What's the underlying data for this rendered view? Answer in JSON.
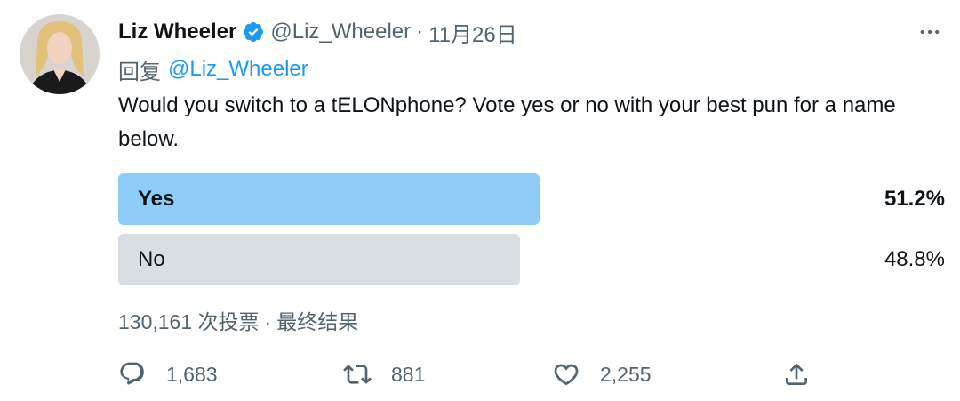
{
  "author": {
    "name": "Liz Wheeler",
    "handle": "@Liz_Wheeler",
    "date": "11月26日",
    "separator": "·"
  },
  "reply": {
    "prefix": "回复",
    "handle": "@Liz_Wheeler"
  },
  "tweet": {
    "text": "Would you switch to a tELONphone? Vote yes or no with your best pun for a name below."
  },
  "poll": {
    "options": [
      {
        "label": "Yes",
        "percent_label": "51.2%",
        "fraction": 0.512,
        "winner": true
      },
      {
        "label": "No",
        "percent_label": "48.8%",
        "fraction": 0.488,
        "winner": false
      }
    ],
    "votes": "130,161 次投票",
    "separator": "·",
    "status": "最终结果"
  },
  "actions": {
    "replies": "1,683",
    "retweets": "881",
    "likes": "2,255"
  },
  "icons": {
    "verified": "verified-badge-icon",
    "more": "more-horizontal-icon",
    "reply": "reply-icon",
    "retweet": "retweet-icon",
    "like": "heart-icon",
    "share": "share-icon"
  },
  "colors": {
    "accent": "#1d9bf0",
    "winner_bar": "#8ecdf8",
    "loser_bar": "#d9dee2",
    "secondary_text": "#536471",
    "primary_text": "#0f1419"
  }
}
